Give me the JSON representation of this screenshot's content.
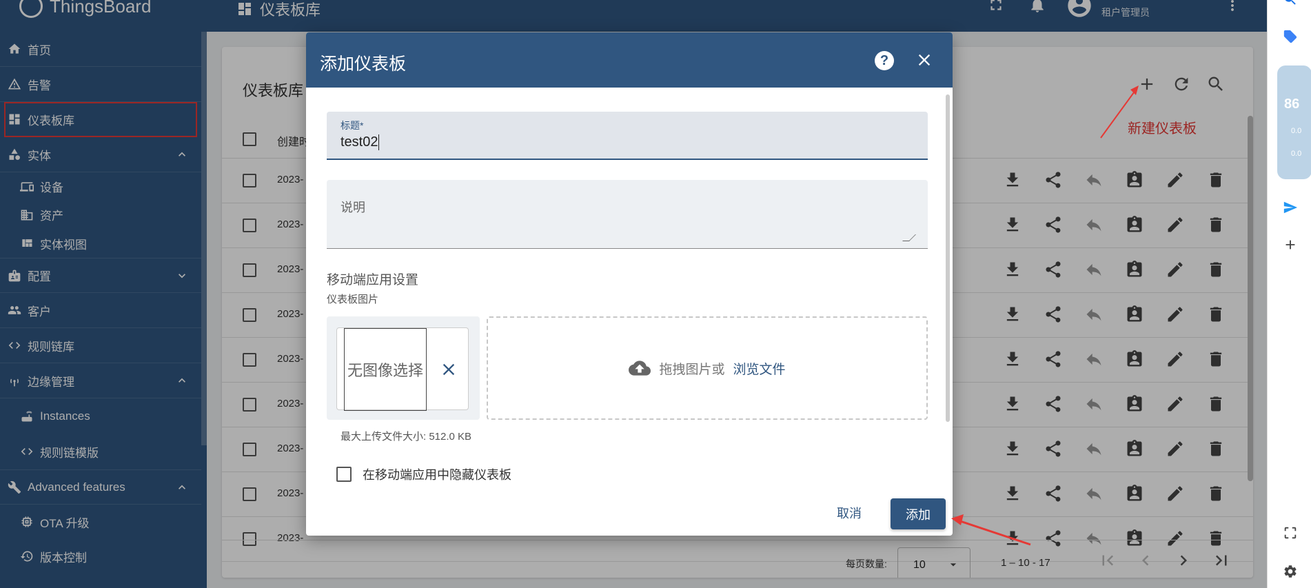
{
  "app": {
    "brand": "ThingsBoard",
    "page_title": "仪表板库",
    "user_role": "租户管理员"
  },
  "sidebar": {
    "items": [
      {
        "label": "首页",
        "icon": "home-icon"
      },
      {
        "label": "告警",
        "icon": "warning-icon"
      },
      {
        "label": "仪表板库",
        "icon": "dashboard-icon",
        "active": true
      },
      {
        "label": "实体",
        "icon": "shapes-icon",
        "expanded": true
      },
      {
        "label": "设备",
        "icon": "device-icon",
        "sub": true
      },
      {
        "label": "资产",
        "icon": "building-icon",
        "sub": true
      },
      {
        "label": "实体视图",
        "icon": "view-quilt-icon",
        "sub": true
      },
      {
        "label": "配置",
        "icon": "badge-icon",
        "expanded": false
      },
      {
        "label": "客户",
        "icon": "people-icon"
      },
      {
        "label": "规则链库",
        "icon": "code-icon"
      },
      {
        "label": "边缘管理",
        "icon": "router-icon",
        "expanded": true
      },
      {
        "label": "Instances",
        "icon": "router-small-icon",
        "sub": true
      },
      {
        "label": "规则链模版",
        "icon": "code-icon",
        "sub": true
      },
      {
        "label": "Advanced features",
        "icon": "build-icon",
        "expanded": true
      },
      {
        "label": "OTA 升级",
        "icon": "memory-icon",
        "sub": true
      },
      {
        "label": "版本控制",
        "icon": "history-icon",
        "sub": true
      }
    ]
  },
  "list": {
    "title": "仪表板库",
    "col_created": "创建时",
    "row_dates": [
      "2023-",
      "2023-",
      "2023-",
      "2023-",
      "2023-",
      "2023-",
      "2023-",
      "2023-",
      "2023-"
    ],
    "paginator": {
      "page_size_label": "每页数量:",
      "page_size": "10",
      "range": "1 – 10 - 17"
    }
  },
  "annotation": {
    "new_dashboard": "新建仪表板"
  },
  "rail": {
    "widget_num": "86",
    "widget_stat1": "0.0",
    "widget_stat2": "0.0"
  },
  "dialog": {
    "title": "添加仪表板",
    "help": "?",
    "title_label": "标题*",
    "title_value": "test02",
    "description_label": "说明",
    "mobile_section": "移动端应用设置",
    "image_label": "仪表板图片",
    "no_image": "无图像选择",
    "drop_text": "拖拽图片或",
    "browse": "浏览文件",
    "max_size": "最大上传文件大小: 512.0 KB",
    "hide_label": "在移动端应用中隐藏仪表板",
    "cancel": "取消",
    "add": "添加"
  },
  "colors": {
    "primary": "#305680",
    "annotation": "#e53935"
  }
}
